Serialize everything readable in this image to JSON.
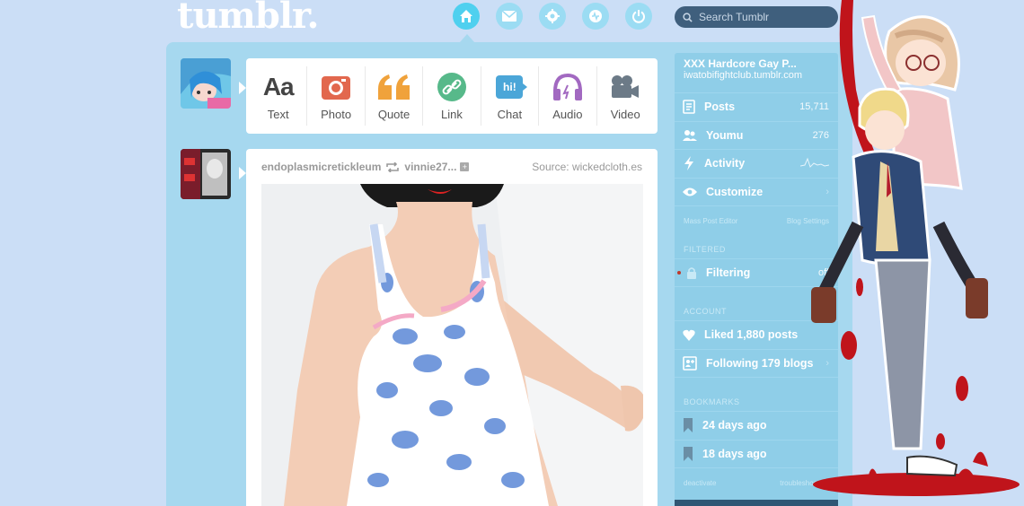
{
  "header": {
    "logo": "tumblr.",
    "nav": [
      {
        "icon": "home-icon",
        "active": true
      },
      {
        "icon": "mail-icon",
        "active": false
      },
      {
        "icon": "settings-icon",
        "active": false
      },
      {
        "icon": "activity-icon",
        "active": false
      },
      {
        "icon": "power-icon",
        "active": false
      }
    ],
    "search_placeholder": "Search Tumblr"
  },
  "post_types": [
    {
      "label": "Text",
      "icon": "text-icon"
    },
    {
      "label": "Photo",
      "icon": "camera-icon"
    },
    {
      "label": "Quote",
      "icon": "quote-icon",
      "glyph": "“"
    },
    {
      "label": "Link",
      "icon": "link-icon"
    },
    {
      "label": "Chat",
      "icon": "chat-icon",
      "glyph": "hi!"
    },
    {
      "label": "Audio",
      "icon": "headphones-icon"
    },
    {
      "label": "Video",
      "icon": "video-camera-icon"
    }
  ],
  "text_glyph": "Aa",
  "post": {
    "user": "endoplasmicretickleum",
    "reblogged_from": "vinnie27...",
    "source": "Source: wickedcloth.es"
  },
  "sidebar": {
    "blog_title": "XXX Hardcore Gay P...",
    "blog_url": "iwatobifightclub.tumblr.com",
    "rows": [
      {
        "label": "Posts",
        "count": "15,711",
        "icon": "posts-icon"
      },
      {
        "label": "Youmu",
        "count": "276",
        "icon": "followers-icon"
      },
      {
        "label": "Activity",
        "count": "",
        "icon": "lightning-icon"
      },
      {
        "label": "Customize",
        "count": "",
        "icon": "eye-icon"
      }
    ],
    "small_links": [
      "Mass Post Editor",
      "Blog Settings"
    ],
    "section_filtered": "FILTERED",
    "filtering": {
      "label": "Filtering",
      "value": "off"
    },
    "section_account": "ACCOUNT",
    "account_rows": [
      {
        "label": "Liked 1,880 posts",
        "icon": "heart-icon"
      },
      {
        "label": "Following 179 blogs",
        "icon": "following-icon"
      }
    ],
    "section_bookmarks": "BOOKMARKS",
    "bookmarks": [
      {
        "label": "24 days ago",
        "icon": "bookmark-icon"
      },
      {
        "label": "18 days ago",
        "icon": "bookmark-icon"
      }
    ],
    "bottom_links": [
      "deactivate",
      "troubleshooting"
    ]
  },
  "colors": {
    "background": "#cbdef6",
    "panel": "#a6d8ef",
    "sidebar": "#8fcee8",
    "photo_red": "#e2684e",
    "quote_orange": "#f0a23b",
    "link_green": "#57b98a",
    "chat_blue": "#4ba6d8",
    "audio_purple": "#a269c1",
    "video_gray": "#6c7a87"
  }
}
